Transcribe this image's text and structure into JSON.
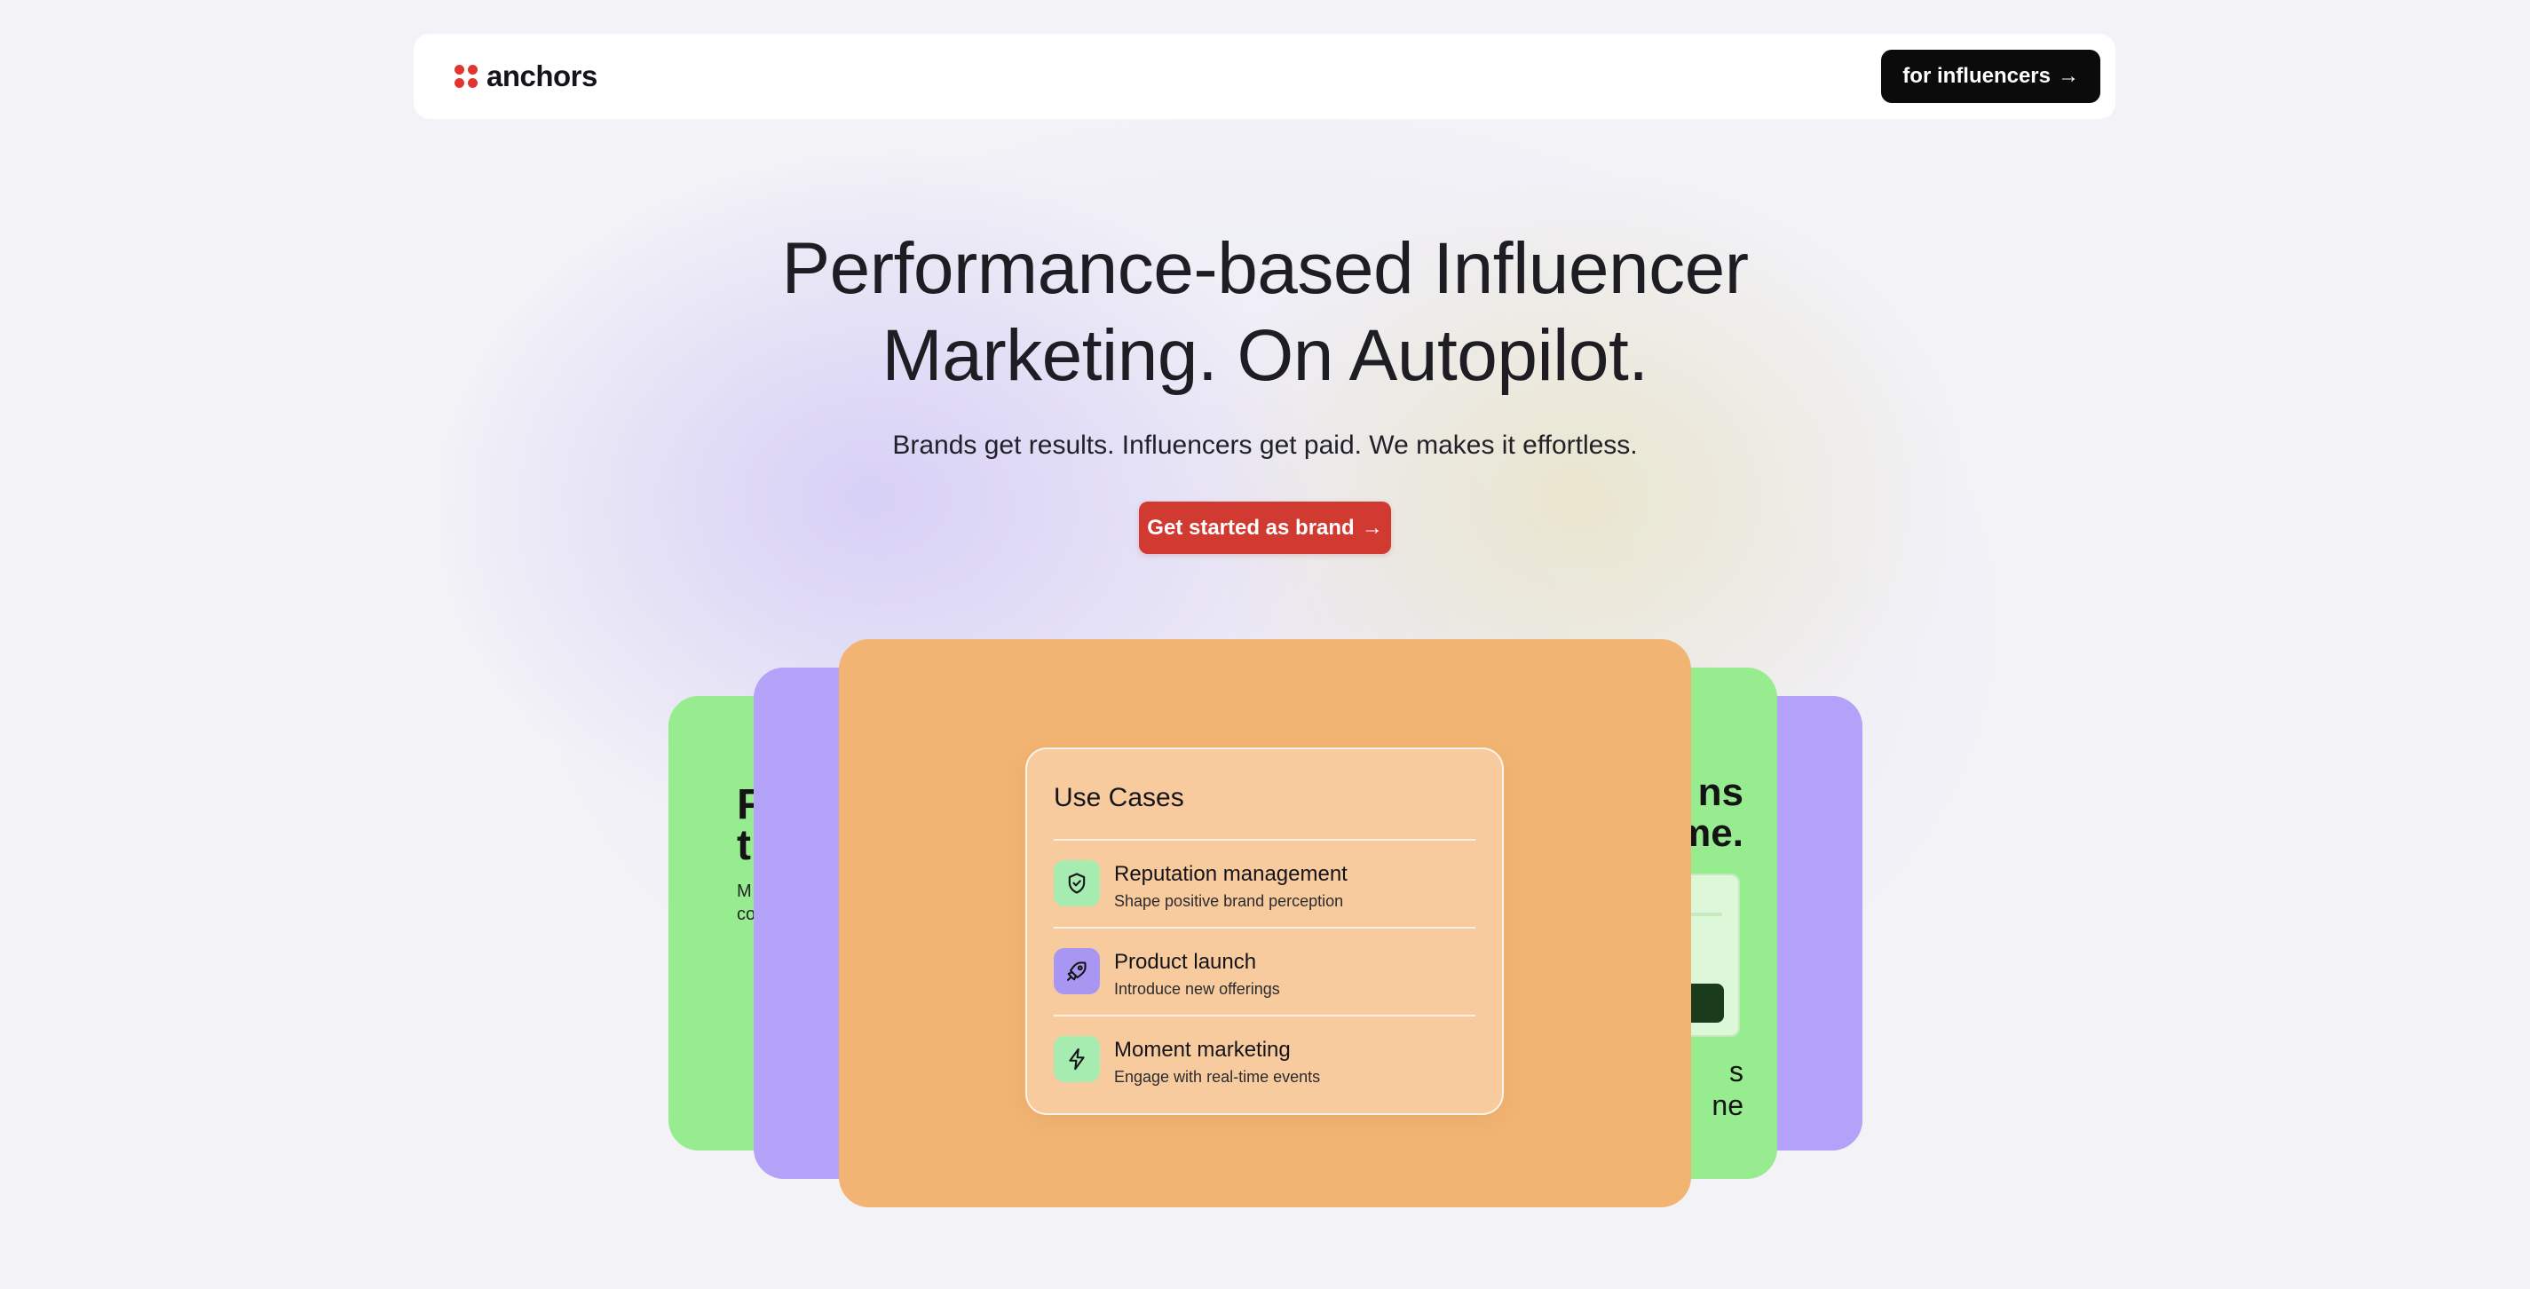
{
  "nav": {
    "logo_text": "anchors",
    "cta_label": "for influencers",
    "cta_arrow": "→"
  },
  "hero": {
    "title_line1": "Performance-based Influencer",
    "title_line2": "Marketing. On Autopilot.",
    "subtitle": "Brands get results. Influencers get paid. We makes it effortless.",
    "cta_label": "Get started as brand",
    "cta_arrow": "→"
  },
  "cards": {
    "left_peek_title": "F\nt",
    "left_peek_sub": "M\nco",
    "right_peek_title": "ns\nme.",
    "right_peek_bottom": "s\nne"
  },
  "use_cases": {
    "title": "Use Cases",
    "items": [
      {
        "name": "Reputation management",
        "description": "Shape positive brand perception",
        "icon": "shield-icon",
        "color": "#a6ecb0"
      },
      {
        "name": "Product launch",
        "description": "Introduce new offerings",
        "icon": "rocket-icon",
        "color": "#a796f2"
      },
      {
        "name": "Moment marketing",
        "description": "Engage with real-time events",
        "icon": "lightning-icon",
        "color": "#a6ecb0"
      }
    ]
  },
  "colors": {
    "brand_red": "#d03a31",
    "logo_red": "#e0362f",
    "card_orange": "#f2b473",
    "card_green": "#96ec8f",
    "card_purple": "#b3a2f7",
    "nav_button": "#0b0b0c"
  }
}
